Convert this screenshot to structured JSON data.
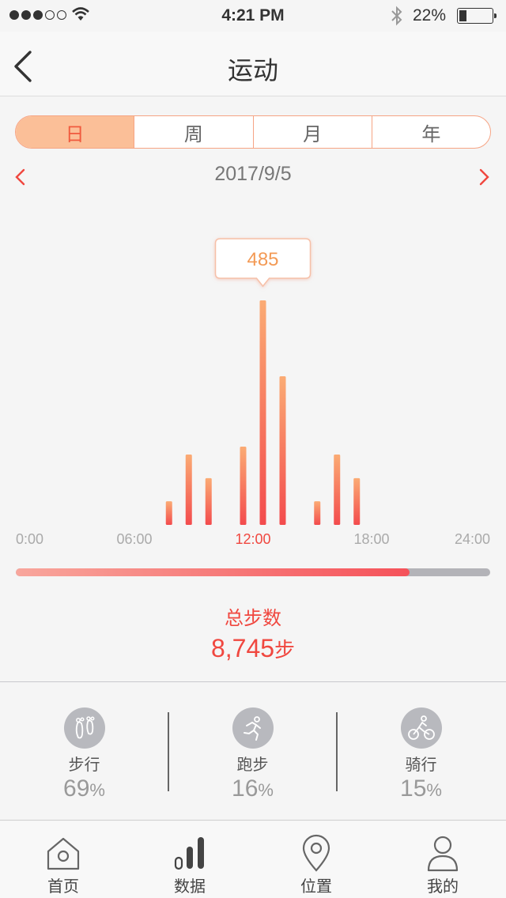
{
  "status_bar": {
    "time": "4:21 PM",
    "battery": "22%",
    "battery_level": 0.22
  },
  "nav": {
    "title": "运动"
  },
  "segments": [
    {
      "label": "日",
      "active": true
    },
    {
      "label": "周",
      "active": false
    },
    {
      "label": "月",
      "active": false
    },
    {
      "label": "年",
      "active": false
    }
  ],
  "date": "2017/9/5",
  "colors": {
    "accent": "#f0473f",
    "bar_top": "#fbab74",
    "bar_bottom": "#f34b4d",
    "segment_active_bg": "#fbbf98"
  },
  "chart_data": {
    "type": "bar",
    "x_ticks": [
      "0:00",
      "06:00",
      "12:00",
      "18:00",
      "24:00"
    ],
    "highlight_tick": "12:00",
    "xlim": [
      0,
      24
    ],
    "ylim": [
      0,
      485
    ],
    "bars": [
      {
        "x": 7.75,
        "y": 51
      },
      {
        "x": 8.75,
        "y": 152
      },
      {
        "x": 9.75,
        "y": 101
      },
      {
        "x": 11.5,
        "y": 169
      },
      {
        "x": 12.5,
        "y": 485
      },
      {
        "x": 13.5,
        "y": 321
      },
      {
        "x": 15.25,
        "y": 51
      },
      {
        "x": 16.25,
        "y": 152
      },
      {
        "x": 17.25,
        "y": 101
      }
    ],
    "tooltip": {
      "value": "485",
      "bar_index": 4
    }
  },
  "progress": {
    "value": 0.83
  },
  "total": {
    "label": "总步数",
    "value": "8,745",
    "unit": "步"
  },
  "stats": [
    {
      "icon": "footprints-icon",
      "label": "步行",
      "value": "69",
      "unit": "%"
    },
    {
      "icon": "running-icon",
      "label": "跑步",
      "value": "16",
      "unit": "%"
    },
    {
      "icon": "cycling-icon",
      "label": "骑行",
      "value": "15",
      "unit": "%"
    }
  ],
  "tabbar": [
    {
      "icon": "home-icon",
      "label": "首页"
    },
    {
      "icon": "bar-chart-icon",
      "label": "数据",
      "active": true
    },
    {
      "icon": "location-icon",
      "label": "位置"
    },
    {
      "icon": "user-icon",
      "label": "我的"
    }
  ]
}
